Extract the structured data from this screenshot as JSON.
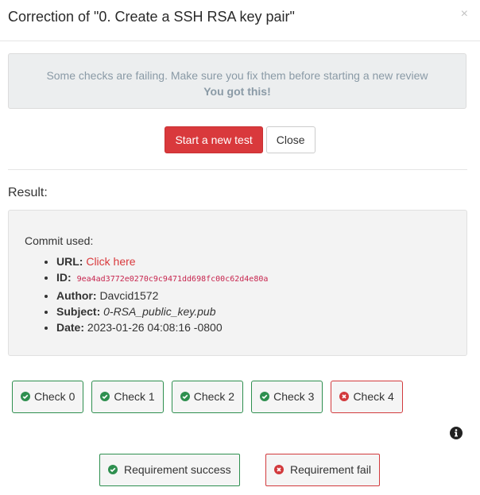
{
  "modal": {
    "title": "Correction of \"0. Create a SSH RSA key pair\"",
    "close_symbol": "×"
  },
  "alert": {
    "message": "Some checks are failing. Make sure you fix them before starting a new review",
    "encouragement": "You got this!"
  },
  "buttons": {
    "start_new_test": "Start a new test",
    "close": "Close"
  },
  "result": {
    "title": "Result:",
    "commit_label": "Commit used:",
    "url_label": "URL:",
    "url_link_text": "Click here",
    "id_label": "ID:",
    "id_value": "9ea4ad3772e0270c9c9471dd698fc00c62d4e80a",
    "author_label": "Author:",
    "author_value": "Davcid1572",
    "subject_label": "Subject:",
    "subject_value": "0-RSA_public_key.pub",
    "date_label": "Date:",
    "date_value": "2023-01-26 04:08:16 -0800"
  },
  "checks": [
    {
      "label": "Check 0",
      "status": "success"
    },
    {
      "label": "Check 1",
      "status": "success"
    },
    {
      "label": "Check 2",
      "status": "success"
    },
    {
      "label": "Check 3",
      "status": "success"
    },
    {
      "label": "Check 4",
      "status": "fail"
    }
  ],
  "legend": {
    "success_label": "Requirement success",
    "fail_label": "Requirement fail"
  },
  "icons": {
    "success": "check-circle-icon",
    "fail": "times-circle-icon",
    "info": "info-circle-icon"
  },
  "colors": {
    "success": "#2e8f4f",
    "fail": "#d23a3d",
    "link": "#d9393c",
    "hash": "#c7254e"
  }
}
